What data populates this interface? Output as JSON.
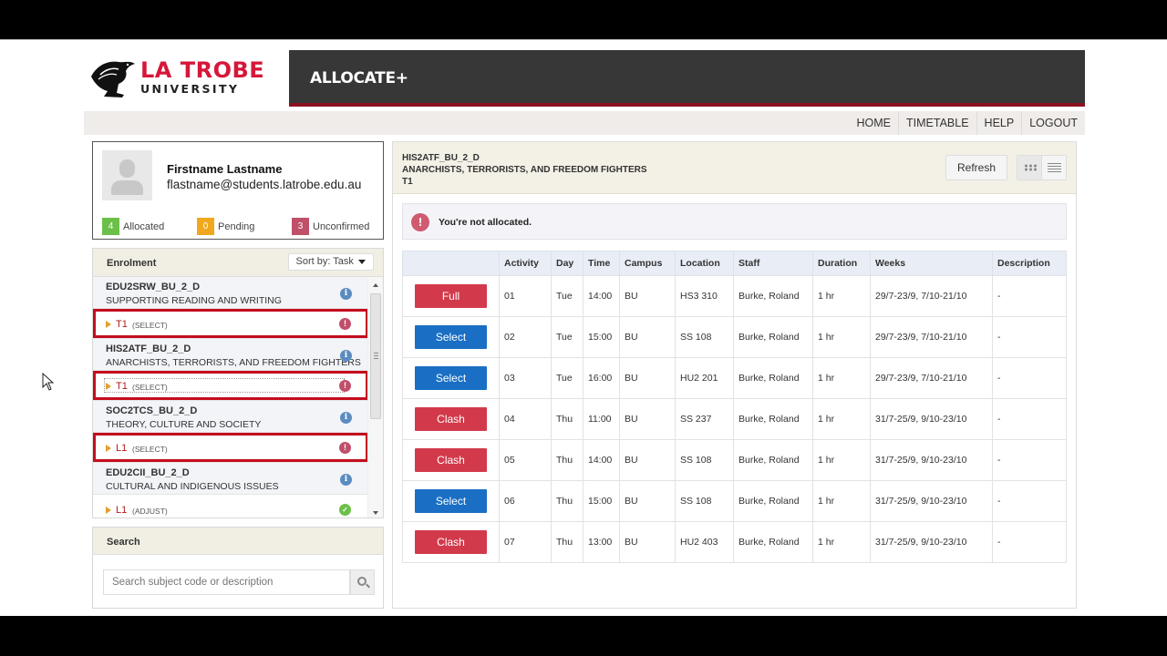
{
  "header": {
    "logo_line1": "LA TROBE",
    "logo_line2": "UNIVERSITY",
    "app_title": "ALLOCATE+",
    "nav": [
      "HOME",
      "TIMETABLE",
      "HELP",
      "LOGOUT"
    ]
  },
  "profile": {
    "name": "Firstname Lastname",
    "email": "flastname@students.latrobe.edu.au",
    "stats": [
      {
        "count": "4",
        "label": "Allocated",
        "color": "#6cc04a"
      },
      {
        "count": "0",
        "label": "Pending",
        "color": "#f0a81e"
      },
      {
        "count": "3",
        "label": "Unconfirmed",
        "color": "#c0506a"
      }
    ]
  },
  "enrolment": {
    "title": "Enrolment",
    "sort_label": "Sort by: Task",
    "subjects": [
      {
        "code": "EDU2SRW_BU_2_D",
        "desc": "SUPPORTING READING AND WRITING",
        "task": {
          "code": "T1",
          "action": "(SELECT)",
          "status": "warning",
          "highlighted": true
        }
      },
      {
        "code": "HIS2ATF_BU_2_D",
        "desc": "ANARCHISTS, TERRORISTS, AND FREEDOM FIGHTERS",
        "task": {
          "code": "T1",
          "action": "(SELECT)",
          "status": "warning",
          "highlighted": true
        }
      },
      {
        "code": "SOC2TCS_BU_2_D",
        "desc": "THEORY, CULTURE AND SOCIETY",
        "task": {
          "code": "L1",
          "action": "(SELECT)",
          "status": "warning",
          "highlighted": true
        }
      },
      {
        "code": "EDU2CII_BU_2_D",
        "desc": "CULTURAL AND INDIGENOUS ISSUES",
        "task": {
          "code": "L1",
          "action": "(ADJUST)",
          "status": "ok",
          "highlighted": false
        }
      }
    ]
  },
  "search": {
    "title": "Search",
    "placeholder": "Search subject code or description"
  },
  "main": {
    "subject_code": "HIS2ATF_BU_2_D",
    "subject_name": "ANARCHISTS, TERRORISTS, AND FREEDOM FIGHTERS",
    "activity_group": "T1",
    "refresh_label": "Refresh",
    "alert": "You're not allocated.",
    "columns": [
      "",
      "Activity",
      "Day",
      "Time",
      "Campus",
      "Location",
      "Staff",
      "Duration",
      "Weeks",
      "Description"
    ],
    "rows": [
      {
        "button": "Full",
        "button_color": "#d23a4b",
        "activity": "01",
        "day": "Tue",
        "time": "14:00",
        "campus": "BU",
        "location": "HS3 310",
        "staff": "Burke, Roland",
        "duration": "1 hr",
        "weeks": "29/7-23/9, 7/10-21/10",
        "description": "-"
      },
      {
        "button": "Select",
        "button_color": "#1a6fc4",
        "activity": "02",
        "day": "Tue",
        "time": "15:00",
        "campus": "BU",
        "location": "SS 108",
        "staff": "Burke, Roland",
        "duration": "1 hr",
        "weeks": "29/7-23/9, 7/10-21/10",
        "description": "-"
      },
      {
        "button": "Select",
        "button_color": "#1a6fc4",
        "activity": "03",
        "day": "Tue",
        "time": "16:00",
        "campus": "BU",
        "location": "HU2 201",
        "staff": "Burke, Roland",
        "duration": "1 hr",
        "weeks": "29/7-23/9, 7/10-21/10",
        "description": "-"
      },
      {
        "button": "Clash",
        "button_color": "#d23a4b",
        "activity": "04",
        "day": "Thu",
        "time": "11:00",
        "campus": "BU",
        "location": "SS 237",
        "staff": "Burke, Roland",
        "duration": "1 hr",
        "weeks": "31/7-25/9, 9/10-23/10",
        "description": "-"
      },
      {
        "button": "Clash",
        "button_color": "#d23a4b",
        "activity": "05",
        "day": "Thu",
        "time": "14:00",
        "campus": "BU",
        "location": "SS 108",
        "staff": "Burke, Roland",
        "duration": "1 hr",
        "weeks": "31/7-25/9, 9/10-23/10",
        "description": "-"
      },
      {
        "button": "Select",
        "button_color": "#1a6fc4",
        "activity": "06",
        "day": "Thu",
        "time": "15:00",
        "campus": "BU",
        "location": "SS 108",
        "staff": "Burke, Roland",
        "duration": "1 hr",
        "weeks": "31/7-25/9, 9/10-23/10",
        "description": "-"
      },
      {
        "button": "Clash",
        "button_color": "#d23a4b",
        "activity": "07",
        "day": "Thu",
        "time": "13:00",
        "campus": "BU",
        "location": "HU2 403",
        "staff": "Burke, Roland",
        "duration": "1 hr",
        "weeks": "31/7-25/9, 9/10-23/10",
        "description": "-"
      }
    ]
  }
}
